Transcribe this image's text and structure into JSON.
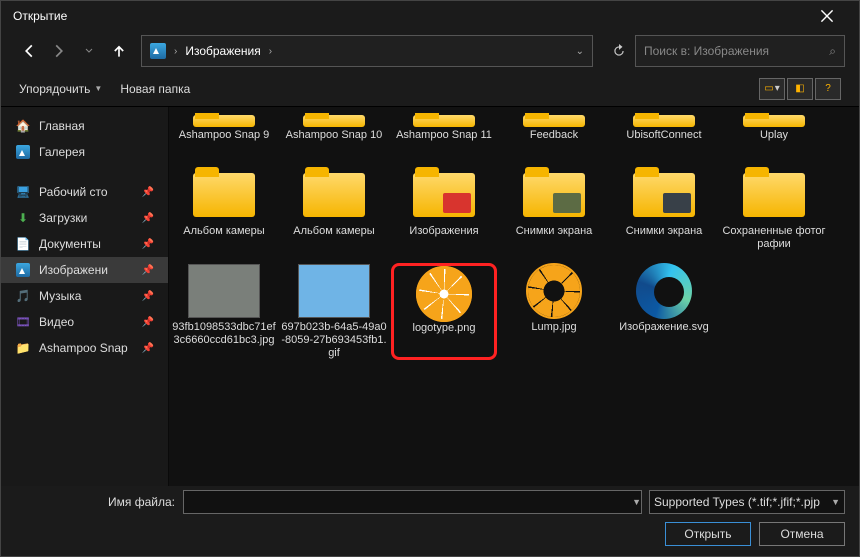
{
  "window": {
    "title": "Открытие"
  },
  "path": {
    "current": "Изображения"
  },
  "search": {
    "placeholder": "Поиск в: Изображения"
  },
  "commands": {
    "organize": "Упорядочить",
    "newfolder": "Новая папка"
  },
  "sidebar": {
    "home": "Главная",
    "gallery": "Галерея",
    "desktop": "Рабочий сто",
    "downloads": "Загрузки",
    "documents": "Документы",
    "pictures": "Изображени",
    "music": "Музыка",
    "video": "Видео",
    "ashampoo": "Ashampoo Snap"
  },
  "files": {
    "row1": [
      "Ashampoo Snap 9",
      "Ashampoo Snap 10",
      "Ashampoo Snap 11",
      "Feedback",
      "UbisoftConnect",
      "Uplay"
    ],
    "row2": [
      {
        "l": "Альбом камеры"
      },
      {
        "l": "Альбом камеры"
      },
      {
        "l": "Изображения",
        "ov": "#d8342e"
      },
      {
        "l": "Снимки экрана",
        "ov": "#5c6b44"
      },
      {
        "l": "Снимки экрана",
        "ov": "#384048"
      },
      {
        "l": "Сохраненные фотографии"
      }
    ],
    "row3": [
      {
        "l": "93fb1098533dbc71ef3c6660ccd61bc3.jpg",
        "t": "img",
        "bg": "#7a7f7a"
      },
      {
        "l": "697b023b-64a5-49a0-8059-27b693453fb1.gif",
        "t": "img",
        "bg": "#6fb4e6"
      },
      {
        "l": "logotype.png",
        "t": "orange",
        "hl": true
      },
      {
        "l": "Lump.jpg",
        "t": "orange-out"
      },
      {
        "l": "Изображение.svg",
        "t": "edge"
      }
    ]
  },
  "footer": {
    "filename_label": "Имя файла:",
    "filter": "Supported Types (*.tif;*.jfif;*.pjp",
    "open": "Открыть",
    "cancel": "Отмена"
  }
}
